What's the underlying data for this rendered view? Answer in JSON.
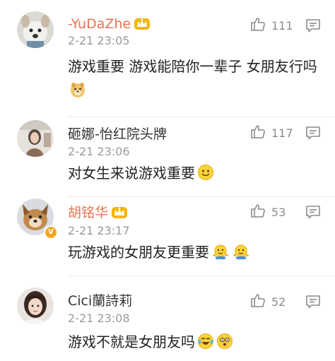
{
  "comments": [
    {
      "username": "-YuDaZhe",
      "time": "2-21 23:05",
      "likes": "111",
      "text": "游戏重要  游戏能陪你一辈子 女朋友行吗",
      "emoji": [
        "doge"
      ]
    },
    {
      "username": "砸娜-怡红院头牌",
      "time": "2-21 23:06",
      "likes": "117",
      "text": "对女生来说游戏重要",
      "emoji": [
        "smile"
      ]
    },
    {
      "username": "胡铭华",
      "time": "2-21 23:17",
      "likes": "53",
      "text": "玩游戏的女朋友更重要",
      "emoji": [
        "shrug",
        "shrug"
      ]
    },
    {
      "username": "Cici蘭詩莉",
      "time": "2-21 23:08",
      "likes": "52",
      "text": "游戏不就是女朋友吗",
      "emoji": [
        "tears-of-joy",
        "dizzy"
      ]
    }
  ],
  "icons": {
    "like": "thumbs-up-icon",
    "reply": "comment-icon",
    "vip": "crown-icon",
    "verified": "verified-v-icon"
  },
  "colors": {
    "vip_name": "#eb7350",
    "normal_name": "#333333",
    "meta_gray": "#9b9b9b",
    "text": "#222222"
  }
}
